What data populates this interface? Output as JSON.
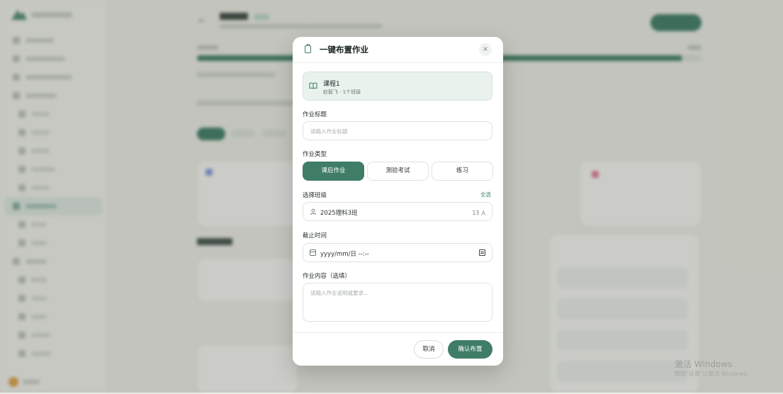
{
  "modal": {
    "title": "一键布置作业",
    "close_glyph": "×",
    "course": {
      "name": "课程1",
      "meta": "赵毅飞 · 1个班级"
    },
    "title_field": {
      "label": "作业标题",
      "placeholder": "请输入作业标题"
    },
    "type_field": {
      "label": "作业类型",
      "options": [
        "课后作业",
        "测验考试",
        "练习"
      ],
      "selected": "课后作业"
    },
    "class_field": {
      "label": "选择班级",
      "select_all": "全选",
      "class_name": "2025理科3班",
      "count": "13 人"
    },
    "deadline_field": {
      "label": "截止时间",
      "value": "yyyy/mm/日 --:--"
    },
    "content_field": {
      "label": "作业内容（选填）",
      "placeholder": "请输入作业说明或要求..."
    },
    "buttons": {
      "cancel": "取消",
      "confirm": "确认布置"
    }
  },
  "watermark": {
    "line1": "激活 Windows",
    "line2": "转到\"设置\"以激活 Windows。"
  },
  "colors": {
    "accent": "#3f7d67",
    "accent_light": "#eaf2ee",
    "text": "#1c2522"
  }
}
